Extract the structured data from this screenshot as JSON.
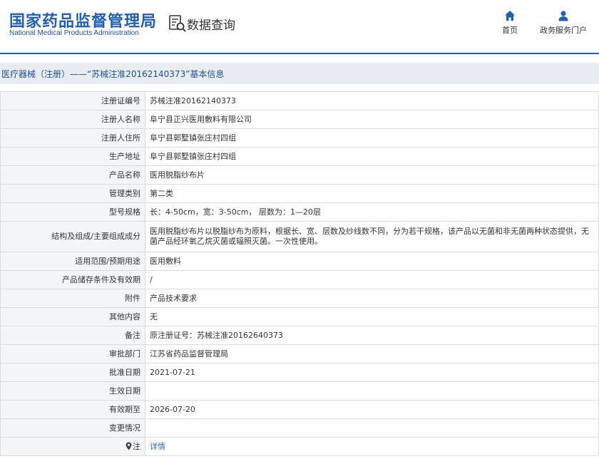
{
  "header": {
    "logo_cn": "国家药品监督管理局",
    "logo_en": "National Medical Products Administration",
    "page_title": "数据查询",
    "nav": [
      {
        "label": "首页",
        "icon": "home-icon"
      },
      {
        "label": "政务服务门户",
        "icon": "user-icon"
      }
    ]
  },
  "record_title": "医疗器械（注册）——“苏械注准20162140373”基本信息",
  "fields": [
    {
      "label": "注册证编号",
      "value": "苏械注准20162140373"
    },
    {
      "label": "注册人名称",
      "value": "阜宁县正兴医用敷料有限公司"
    },
    {
      "label": "注册人住所",
      "value": "阜宁县郭墅镇张庄村四组"
    },
    {
      "label": "生产地址",
      "value": "阜宁县郭墅镇张庄村四组"
    },
    {
      "label": "产品名称",
      "value": "医用脱脂纱布片"
    },
    {
      "label": "管理类别",
      "value": "第二类"
    },
    {
      "label": "型号规格",
      "value": "长：4-50cm，宽：3-50cm， 层数为：1—20层"
    },
    {
      "label": "结构及组成/主要组成成分",
      "value": "医用脱脂纱布片以脱脂纱布为原料，根据长、宽、层数及纱线数不同，分为若干规格，该产品以无菌和非无菌两种状态提供，无菌产品经环氧乙烷灭菌或辐照灭菌。一次性使用。"
    },
    {
      "label": "适用范围/预期用途",
      "value": "医用敷料"
    },
    {
      "label": "产品储存条件及有效期",
      "value": "/"
    },
    {
      "label": "附件",
      "value": "产品技术要求"
    },
    {
      "label": "其他内容",
      "value": "无"
    },
    {
      "label": "备注",
      "value": "原注册证号：苏械注准20162640373"
    },
    {
      "label": "审批部门",
      "value": "江苏省药品监督管理局"
    },
    {
      "label": "批准日期",
      "value": "2021-07-21"
    },
    {
      "label": "生效日期",
      "value": ""
    },
    {
      "label": "有效期至",
      "value": "2026-07-20"
    },
    {
      "label": "变更情况",
      "value": ""
    }
  ],
  "footer_row": {
    "label": "注",
    "value": "详情"
  },
  "colors": {
    "brand": "#1f5fb8",
    "link": "#2b66c3",
    "label_bg": "#f3f5f7",
    "title_bar_bg": "#e9ecf0"
  }
}
